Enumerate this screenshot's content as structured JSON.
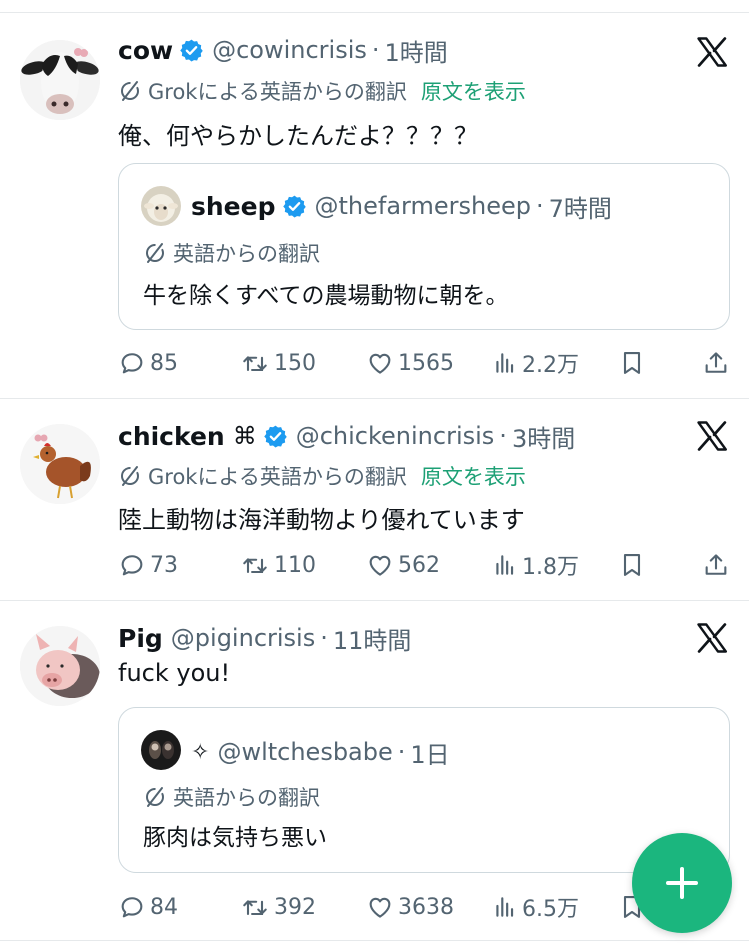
{
  "tweets": [
    {
      "name": "cow",
      "verified": true,
      "handle": "@cowincrisis",
      "separator": "·",
      "time": "1時間",
      "translation_label": "Grokによる英語からの翻訳",
      "show_original": "原文を表示",
      "text": "俺、何やらかしたんだよ？？？？",
      "quote": {
        "name": "sheep",
        "verified": true,
        "handle": "@thefarmersheep",
        "separator": "·",
        "time": "7時間",
        "translation_label": "英語からの翻訳",
        "text": "牛を除くすべての農場動物に朝を。"
      },
      "stats": {
        "replies": "85",
        "retweets": "150",
        "likes": "1565",
        "views": "2.2万"
      }
    },
    {
      "name": "chicken",
      "badge_symbol": "⌘",
      "verified": true,
      "handle": "@chickenincrisis",
      "separator": "·",
      "time": "3時間",
      "translation_label": "Grokによる英語からの翻訳",
      "show_original": "原文を表示",
      "text": "陸上動物は海洋動物より優れています",
      "stats": {
        "replies": "73",
        "retweets": "110",
        "likes": "562",
        "views": "1.8万"
      }
    },
    {
      "name": "Pig",
      "verified": false,
      "handle": "@pigincrisis",
      "separator": "·",
      "time": "11時間",
      "text": "fuck you!",
      "quote": {
        "name": "✧",
        "verified": false,
        "handle": "@wltchesbabe",
        "separator": "·",
        "time": "1日",
        "translation_label": "英語からの翻訳",
        "text": "豚肉は気持ち悪い"
      },
      "stats": {
        "replies": "84",
        "retweets": "392",
        "likes": "3638",
        "views": "6.5万"
      }
    }
  ],
  "colors": {
    "verified_blue": "#1d9bf0",
    "link_green": "#1da075",
    "fab_green": "#1bb67e",
    "muted_text": "#536471",
    "text": "#0f1419",
    "divider": "#e6e9eb"
  },
  "icons": {
    "reply": "speech-bubble-icon",
    "retweet": "retweet-icon",
    "like": "heart-icon",
    "views": "bar-chart-icon",
    "bookmark": "bookmark-icon",
    "share": "share-icon",
    "source": "x-logo-icon",
    "translate": "translate-icon",
    "compose": "plus-icon"
  }
}
